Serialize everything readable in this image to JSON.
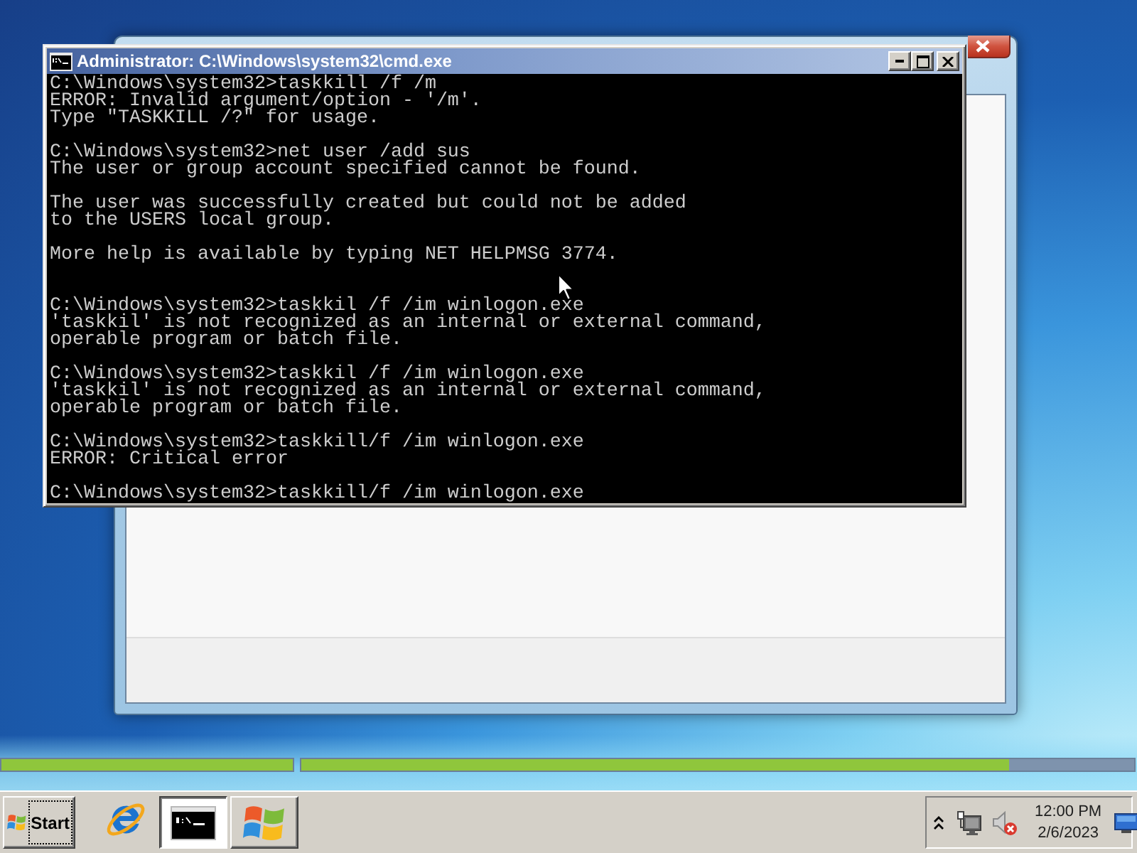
{
  "console_window": {
    "title": "Administrator: C:\\Windows\\system32\\cmd.exe",
    "output": "C:\\Windows\\system32>taskkill /f /m\nERROR: Invalid argument/option - '/m'.\nType \"TASKKILL /?\" for usage.\n\nC:\\Windows\\system32>net user /add sus\nThe user or group account specified cannot be found.\n\nThe user was successfully created but could not be added\nto the USERS local group.\n\nMore help is available by typing NET HELPMSG 3774.\n\n\nC:\\Windows\\system32>taskkil /f /im winlogon.exe\n'taskkil' is not recognized as an internal or external command,\noperable program or batch file.\n\nC:\\Windows\\system32>taskkil /f /im winlogon.exe\n'taskkil' is not recognized as an internal or external command,\noperable program or batch file.\n\nC:\\Windows\\system32>taskkill/f /im winlogon.exe\nERROR: Critical error\n\nC:\\Windows\\system32>taskkill/f /im winlogon.exe"
  },
  "progress_bars": [
    {
      "level": 1
    },
    {
      "level": 0.85
    }
  ],
  "taskbar": {
    "start_button": {
      "label": "Start",
      "focused": true
    },
    "buttons": [
      {
        "kind": "console",
        "selected": true
      },
      {
        "kind": "logo",
        "selected": false
      }
    ],
    "tray": {
      "volume_muted": true,
      "time": "12:00 PM",
      "date": "2/6/2023"
    }
  }
}
